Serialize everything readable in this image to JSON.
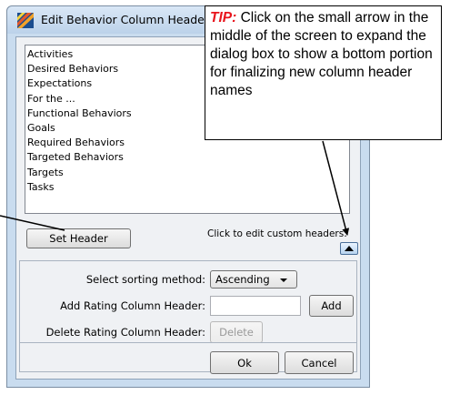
{
  "window": {
    "title": "Edit Behavior Column Headers"
  },
  "list": {
    "items": [
      "Activities",
      "Desired Behaviors",
      "Expectations",
      "For the ...",
      "Functional Behaviors",
      "Goals",
      "Required Behaviors",
      "Targeted Behaviors",
      "Targets",
      "Tasks"
    ]
  },
  "buttons": {
    "set_header": "Set Header",
    "add": "Add",
    "delete": "Delete",
    "ok": "Ok",
    "cancel": "Cancel"
  },
  "hint": "Click to edit custom headers:",
  "form": {
    "sort_label": "Select sorting method:",
    "sort_value": "Ascending",
    "add_label": "Add Rating Column Header:",
    "add_value": "",
    "delete_label": "Delete Rating Column Header:"
  },
  "tip": {
    "label": "TIP:",
    "text": " Click on the small arrow in the middle of the screen to expand the dialog box to show a bottom portion for finalizing  new column header names"
  },
  "colors": {
    "tip_label": "#e8141c",
    "dialog_frame": "#c9dcef",
    "dialog_body": "#eff1f4"
  },
  "icons": {
    "app": "colorful-stripes-icon",
    "expander": "up-arrow-icon"
  }
}
